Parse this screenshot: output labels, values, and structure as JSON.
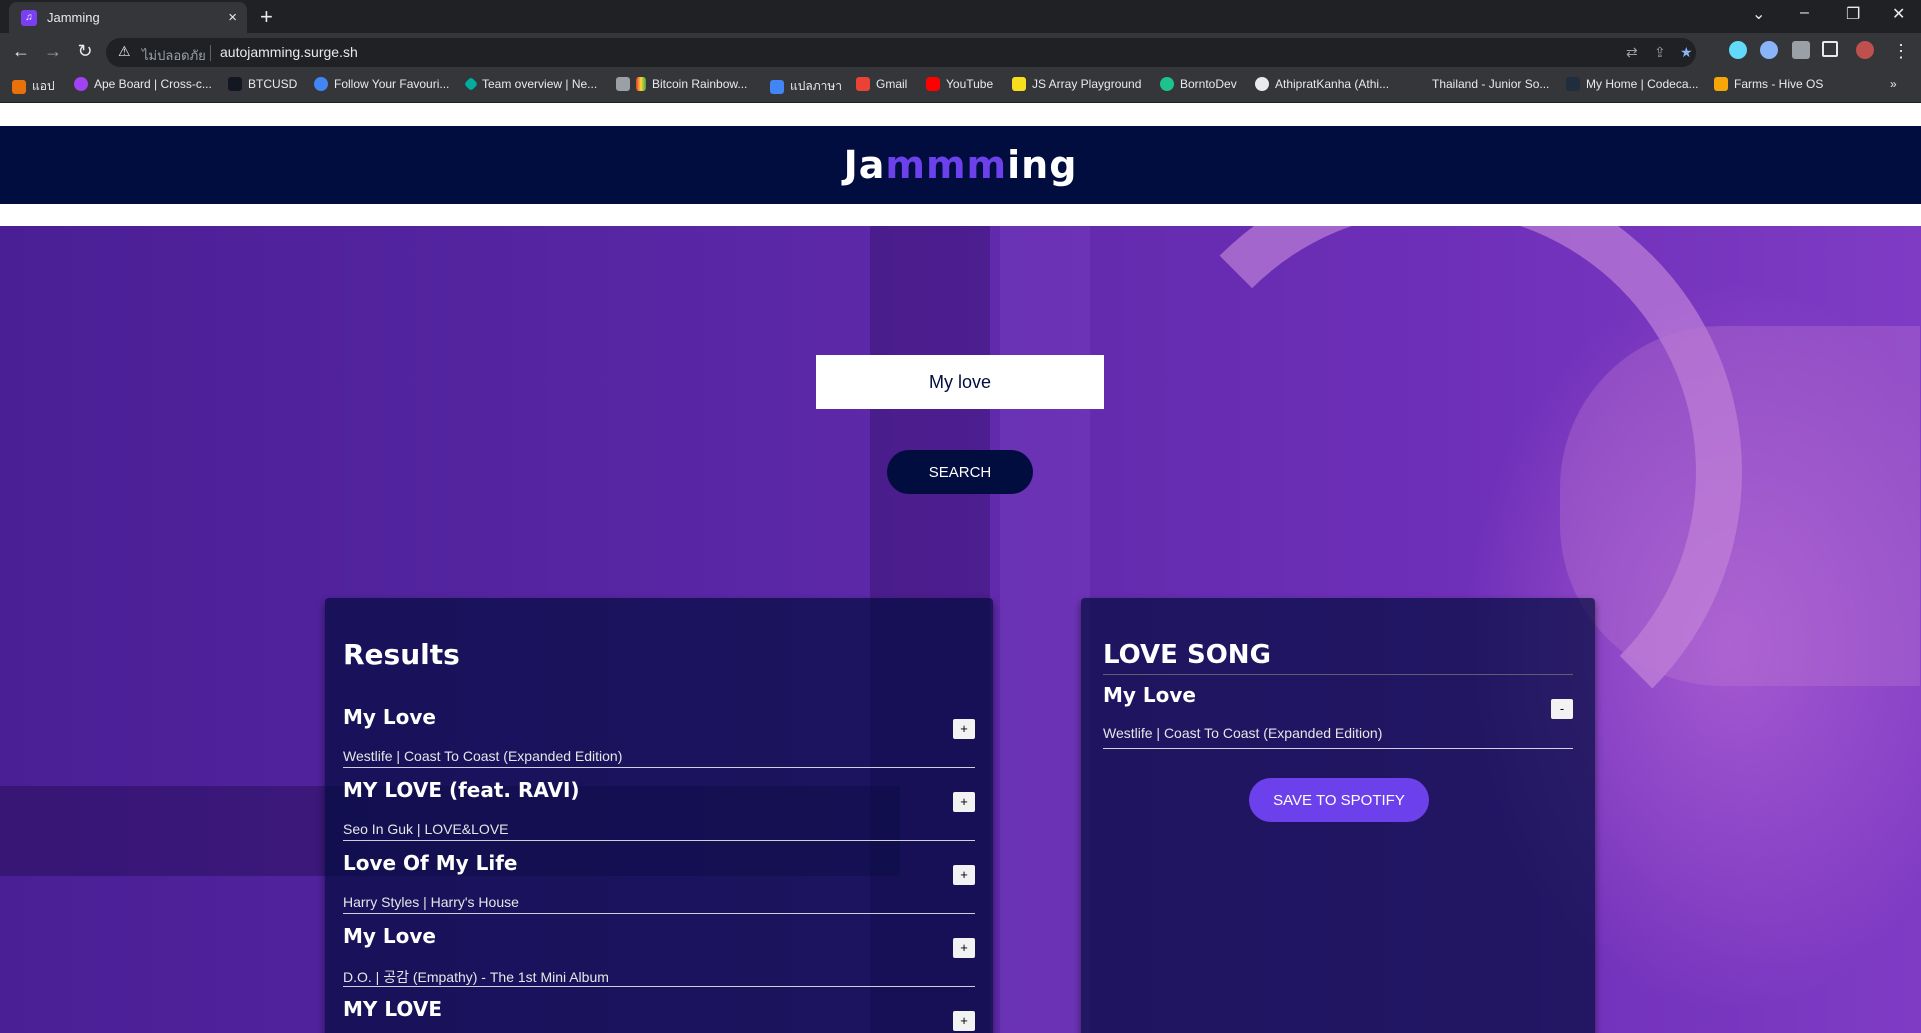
{
  "browser": {
    "tab_title": "Jamming",
    "close_glyph": "×",
    "new_tab_glyph": "+",
    "insecure_label": "ไม่ปลอดภัย",
    "url": "autojamming.surge.sh",
    "bookmarks": [
      {
        "label": "แอป"
      },
      {
        "label": "Ape Board | Cross-c..."
      },
      {
        "label": "BTCUSD"
      },
      {
        "label": "Follow Your Favouri..."
      },
      {
        "label": "Team overview | Ne..."
      },
      {
        "label": "Bitcoin Rainbow..."
      },
      {
        "label": "แปลภาษา"
      },
      {
        "label": "Gmail"
      },
      {
        "label": "YouTube"
      },
      {
        "label": "JS Array Playground"
      },
      {
        "label": "BorntoDev"
      },
      {
        "label": "AthipratKanha (Athi..."
      },
      {
        "label": "Thailand - Junior So..."
      },
      {
        "label": "My Home | Codeca..."
      },
      {
        "label": "Farms - Hive OS"
      }
    ]
  },
  "app": {
    "logo_part1": "Ja",
    "logo_part2": "mmm",
    "logo_part3": "ing",
    "accent_color": "#6c41ec",
    "header_color": "#010c3f"
  },
  "search": {
    "value": "My love",
    "button_label": "SEARCH"
  },
  "results": {
    "title": "Results",
    "add_glyph": "+",
    "tracks": [
      {
        "name": "My Love",
        "meta": "Westlife | Coast To Coast (Expanded Edition)"
      },
      {
        "name": "MY LOVE (feat. RAVI)",
        "meta": "Seo In Guk | LOVE&LOVE"
      },
      {
        "name": "Love Of My Life",
        "meta": "Harry Styles | Harry's House"
      },
      {
        "name": "My Love",
        "meta": "D.O. | 공감 (Empathy) - The 1st Mini Album"
      },
      {
        "name": "MY LOVE",
        "meta": ""
      }
    ]
  },
  "playlist": {
    "name": "LOVE SONG",
    "remove_glyph": "-",
    "tracks": [
      {
        "name": "My Love",
        "meta": "Westlife | Coast To Coast (Expanded Edition)"
      }
    ],
    "save_label": "SAVE TO SPOTIFY"
  }
}
